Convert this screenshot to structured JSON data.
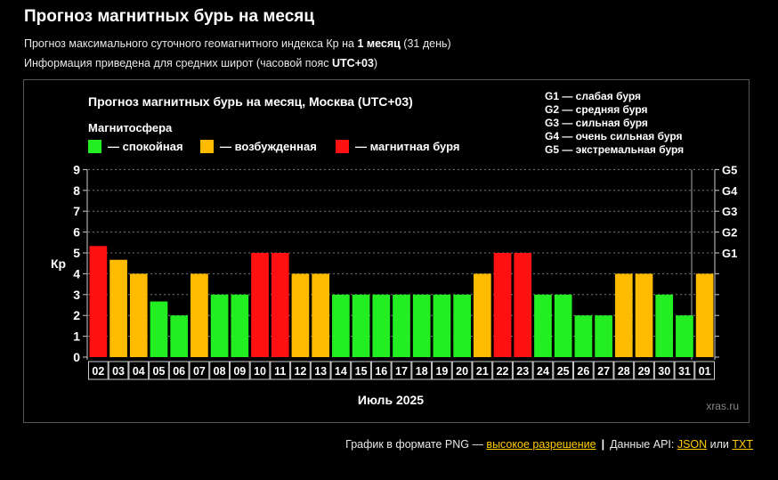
{
  "page": {
    "title": "Прогноз магнитных бурь на месяц",
    "subtitle_pre": "Прогноз максимального суточного геомагнитного индекса Кр на ",
    "subtitle_bold": "1 месяц",
    "subtitle_post": " (31 день)",
    "info_pre": "Информация приведена для средних широт (часовой пояс ",
    "info_bold": "UTC+03",
    "info_post": ")"
  },
  "footer": {
    "png_text": "График в формате PNG — ",
    "png_link": "высокое разрешение",
    "api_text": "Данные API: ",
    "json_link": "JSON",
    "or_text": " или ",
    "txt_link": "TXT"
  },
  "colors": {
    "calm": "#22ee22",
    "excited": "#ffbb00",
    "storm": "#ff1111"
  },
  "chart_data": {
    "type": "bar",
    "title": "Прогноз магнитных бурь на месяц, Москва (UTC+03)",
    "xlabel": "Июль 2025",
    "ylabel": "Кр",
    "ylim": [
      0,
      9
    ],
    "yticks": [
      "0",
      "1",
      "2",
      "3",
      "4",
      "5",
      "6",
      "7",
      "8",
      "9"
    ],
    "g_scale": [
      {
        "label": "G1",
        "kp": 5
      },
      {
        "label": "G2",
        "kp": 6
      },
      {
        "label": "G3",
        "kp": 7
      },
      {
        "label": "G4",
        "kp": 8
      },
      {
        "label": "G5",
        "kp": 9
      }
    ],
    "g_legend": [
      "G1 — слабая буря",
      "G2 — средняя буря",
      "G3 — сильная буря",
      "G4 — очень сильная буря",
      "G5 — экстремальная буря"
    ],
    "legend_title": "Магнитосфера",
    "legend": [
      {
        "label": "— спокойная",
        "level": "calm"
      },
      {
        "label": "— возбужденная",
        "level": "excited"
      },
      {
        "label": "— магнитная буря",
        "level": "storm"
      }
    ],
    "categories": [
      "02",
      "03",
      "04",
      "05",
      "06",
      "07",
      "08",
      "09",
      "10",
      "11",
      "12",
      "13",
      "14",
      "15",
      "16",
      "17",
      "18",
      "19",
      "20",
      "21",
      "22",
      "23",
      "24",
      "25",
      "26",
      "27",
      "28",
      "29",
      "30",
      "31",
      "01"
    ],
    "values": [
      5.33,
      4.67,
      4,
      2.67,
      2,
      4,
      3,
      3,
      5,
      5,
      4,
      4,
      3,
      3,
      3,
      3,
      3,
      3,
      3,
      4,
      5,
      5,
      3,
      3,
      2,
      2,
      4,
      4,
      3,
      2,
      4
    ],
    "levels": [
      "storm",
      "excited",
      "excited",
      "calm",
      "calm",
      "excited",
      "calm",
      "calm",
      "storm",
      "storm",
      "excited",
      "excited",
      "calm",
      "calm",
      "calm",
      "calm",
      "calm",
      "calm",
      "calm",
      "excited",
      "storm",
      "storm",
      "calm",
      "calm",
      "calm",
      "calm",
      "excited",
      "excited",
      "calm",
      "calm",
      "excited"
    ],
    "watermark": "xras.ru",
    "grid": true,
    "legend_position": "top"
  }
}
